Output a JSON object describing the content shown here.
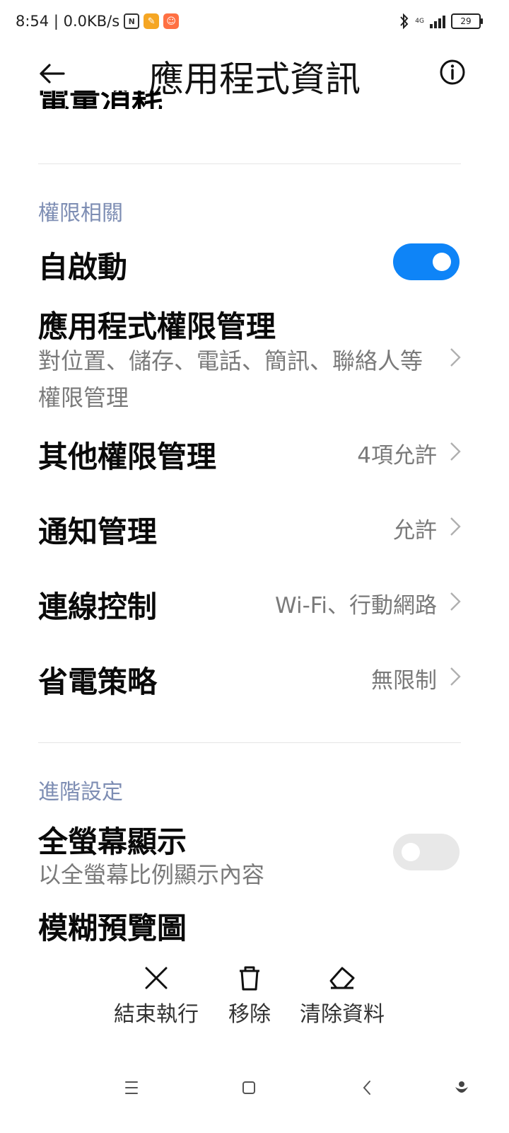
{
  "status_bar": {
    "time_speed": "8:54 | 0.0KB/s",
    "network": "4G",
    "battery": "29",
    "icons": [
      "nfc-icon",
      "app-notification-icon",
      "app-notification-icon-2",
      "bluetooth-icon",
      "signal-icon",
      "battery-icon"
    ]
  },
  "header": {
    "title": "應用程式資訊",
    "back_icon": "arrow-left-icon",
    "info_icon": "info-icon"
  },
  "permissions": {
    "section_title": "權限相關",
    "autostart": {
      "label": "自啟動",
      "enabled": true
    },
    "app_permissions": {
      "label": "應用程式權限管理",
      "sub": "對位置、儲存、電話、簡訊、聯絡人等權限管理"
    },
    "other_permissions": {
      "label": "其他權限管理",
      "value": "4項允許"
    },
    "notifications": {
      "label": "通知管理",
      "value": "允許"
    },
    "connection": {
      "label": "連線控制",
      "value": "Wi-Fi、行動網路"
    },
    "battery_saver": {
      "label": "省電策略",
      "value": "無限制"
    }
  },
  "advanced": {
    "section_title": "進階設定",
    "fullscreen": {
      "label": "全螢幕顯示",
      "sub": "以全螢幕比例顯示內容",
      "enabled": false
    },
    "blur_preview": {
      "label": "模糊預覽圖"
    }
  },
  "actions": {
    "force_stop": "結束執行",
    "uninstall": "移除",
    "clear_data": "清除資料"
  },
  "nav": [
    "menu-icon",
    "home-icon",
    "back-icon",
    "assistant-icon"
  ],
  "colors": {
    "accent": "#0e84f7",
    "section": "#7d8db3",
    "secondary_text": "#7a7a7a"
  }
}
